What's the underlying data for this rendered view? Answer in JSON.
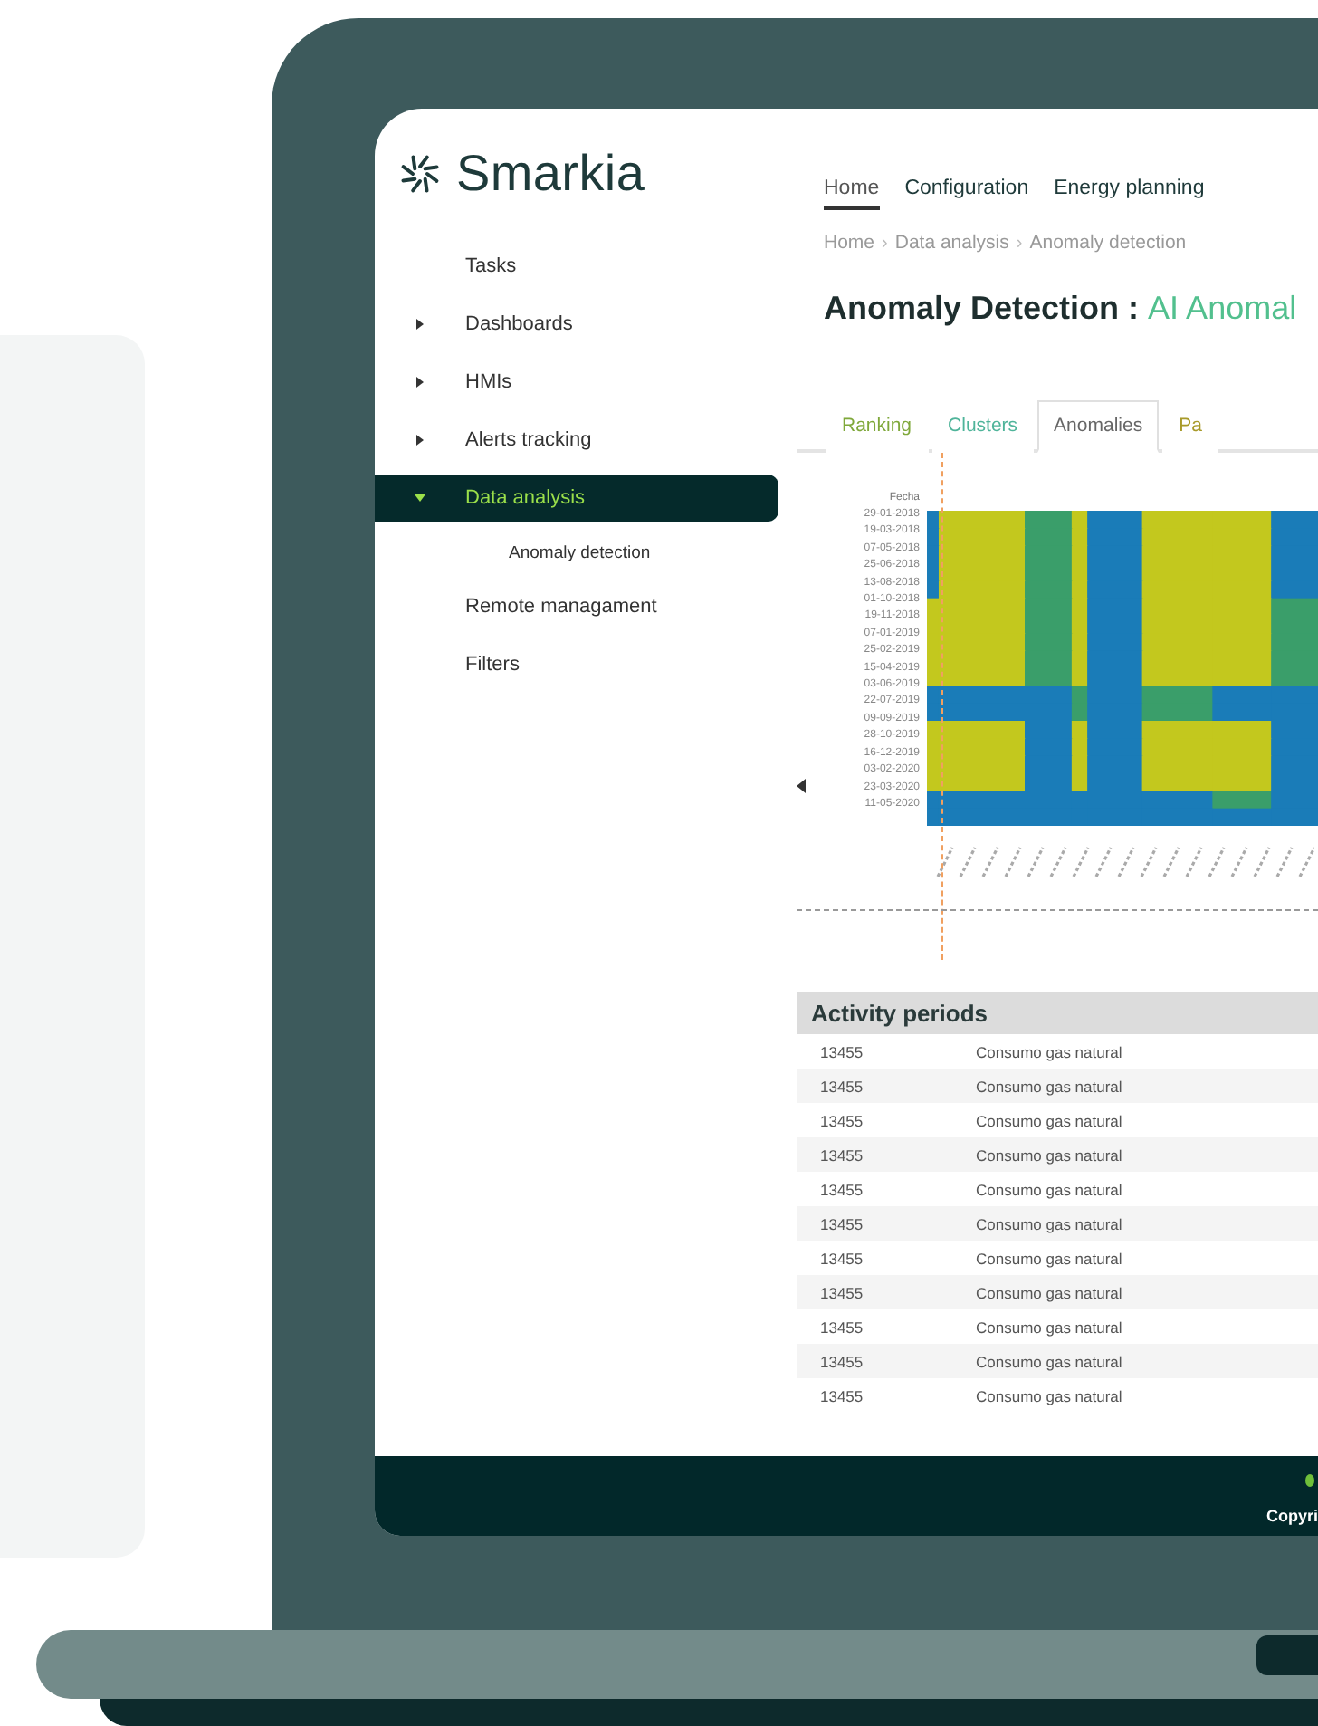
{
  "logo": {
    "text": "Smarkia"
  },
  "sidebar": {
    "items": [
      {
        "label": "Tasks",
        "expandable": false,
        "selected": false
      },
      {
        "label": "Dashboards",
        "expandable": true,
        "expanded": false,
        "selected": false
      },
      {
        "label": "HMIs",
        "expandable": true,
        "expanded": false,
        "selected": false
      },
      {
        "label": "Alerts tracking",
        "expandable": true,
        "expanded": false,
        "selected": false
      },
      {
        "label": "Data analysis",
        "expandable": true,
        "expanded": true,
        "selected": true,
        "children": [
          {
            "label": "Anomaly detection",
            "selected": false
          }
        ]
      },
      {
        "label": "Remote managament",
        "expandable": false,
        "selected": false
      },
      {
        "label": "Filters",
        "expandable": false,
        "selected": false
      }
    ]
  },
  "nav": [
    {
      "label": "Home",
      "selected": true
    },
    {
      "label": "Configuration",
      "selected": false
    },
    {
      "label": "Energy planning",
      "selected": false
    }
  ],
  "breadcrumb": {
    "items": [
      "Home",
      "Data analysis",
      "Anomaly detection"
    ],
    "separator": "›"
  },
  "title": {
    "prefix": "Anomaly Detection :",
    "highlight": "AI Anomal"
  },
  "tabs": [
    {
      "label": "Ranking",
      "selected": false,
      "color": "#7fa83a"
    },
    {
      "label": "Clusters",
      "selected": false,
      "color": "#4fb49a"
    },
    {
      "label": "Anomalies",
      "selected": true,
      "color": "#666666"
    },
    {
      "label": "Pa",
      "selected": false,
      "color": "#a89a2a"
    }
  ],
  "heatmap": {
    "y_axis_title": "Fecha",
    "y_labels": [
      "29-01-2018",
      "19-03-2018",
      "07-05-2018",
      "25-06-2018",
      "13-08-2018",
      "01-10-2018",
      "19-11-2018",
      "07-01-2019",
      "25-02-2019",
      "15-04-2019",
      "03-06-2019",
      "22-07-2019",
      "09-09-2019",
      "28-10-2019",
      "16-12-2019",
      "03-02-2020",
      "23-03-2020",
      "11-05-2020"
    ]
  },
  "table": {
    "title": "Activity periods",
    "rows": [
      [
        "13455",
        "Consumo gas natural"
      ],
      [
        "13455",
        "Consumo gas natural"
      ],
      [
        "13455",
        "Consumo gas natural"
      ],
      [
        "13455",
        "Consumo gas natural"
      ],
      [
        "13455",
        "Consumo gas natural"
      ],
      [
        "13455",
        "Consumo gas natural"
      ],
      [
        "13455",
        "Consumo gas natural"
      ],
      [
        "13455",
        "Consumo gas natural"
      ],
      [
        "13455",
        "Consumo gas natural"
      ],
      [
        "13455",
        "Consumo gas natural"
      ],
      [
        "13455",
        "Consumo gas natural"
      ]
    ]
  },
  "footer": {
    "text": "Copyri"
  }
}
